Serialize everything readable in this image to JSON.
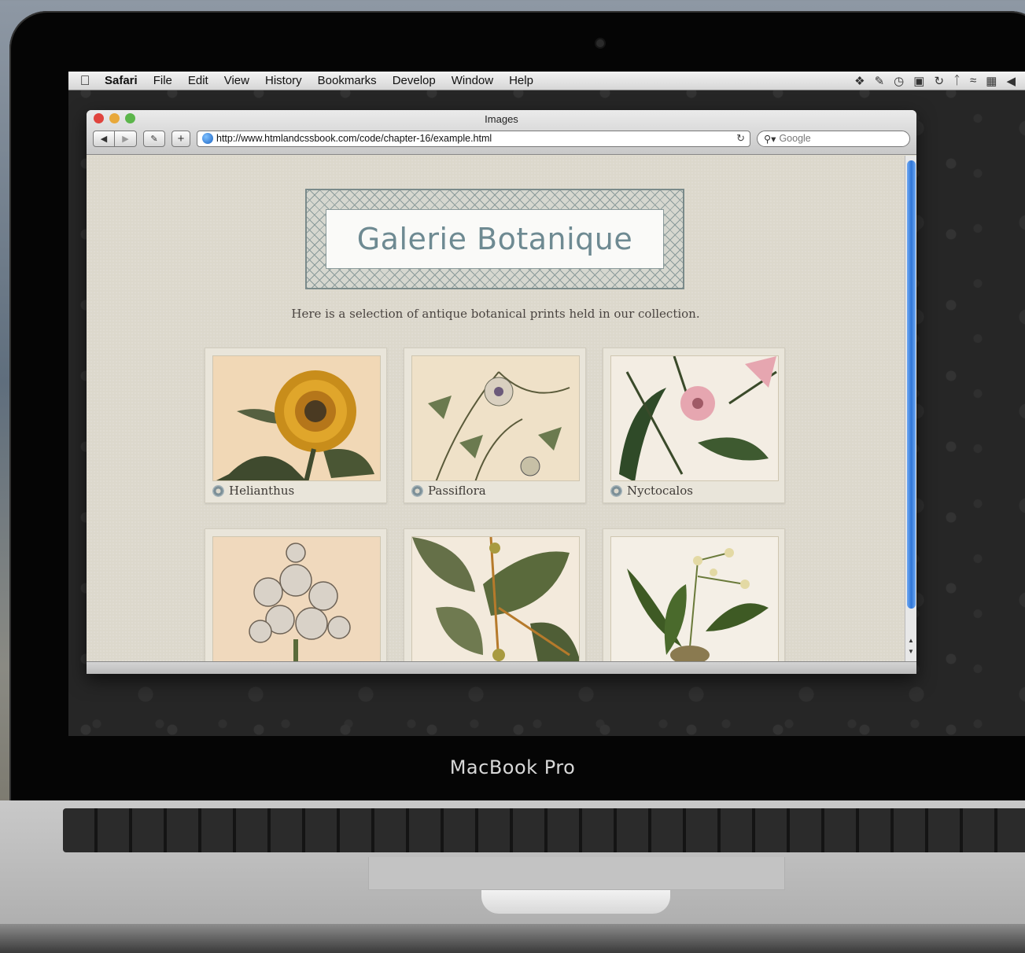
{
  "device": {
    "label": "MacBook Pro"
  },
  "menubar": {
    "app_name": "Safari",
    "items": [
      "File",
      "Edit",
      "View",
      "History",
      "Bookmarks",
      "Develop",
      "Window",
      "Help"
    ],
    "status_icons": [
      "dropbox-icon",
      "evernote-icon",
      "time-machine-icon",
      "display-icon",
      "sync-icon",
      "bluetooth-icon",
      "wifi-icon",
      "keyboard-icon",
      "volume-icon"
    ]
  },
  "browser": {
    "window_title": "Images",
    "url": "http://www.htmlandcssbook.com/code/chapter-16/example.html",
    "search_placeholder": "Google"
  },
  "page": {
    "logo_text": "Galerie Botanique",
    "intro": "Here is a selection of antique botanical prints held in our collection.",
    "gallery": [
      {
        "caption": "Helianthus",
        "palette": [
          "#f1d8b6",
          "#c88d1b",
          "#3f4a2e"
        ]
      },
      {
        "caption": "Passiflora",
        "palette": [
          "#efe1c8",
          "#6b7a4f",
          "#3a3a2a"
        ]
      },
      {
        "caption": "Nyctocalos",
        "palette": [
          "#f3ede3",
          "#e6a6b0",
          "#2f4a28"
        ]
      },
      {
        "caption": "",
        "palette": [
          "#f0d9bd",
          "#d9d2c8",
          "#6d6255"
        ]
      },
      {
        "caption": "",
        "palette": [
          "#f3eadc",
          "#657048",
          "#b67a2b"
        ]
      },
      {
        "caption": "",
        "palette": [
          "#f4efe6",
          "#3e5a24",
          "#e3d9a4"
        ]
      }
    ]
  }
}
